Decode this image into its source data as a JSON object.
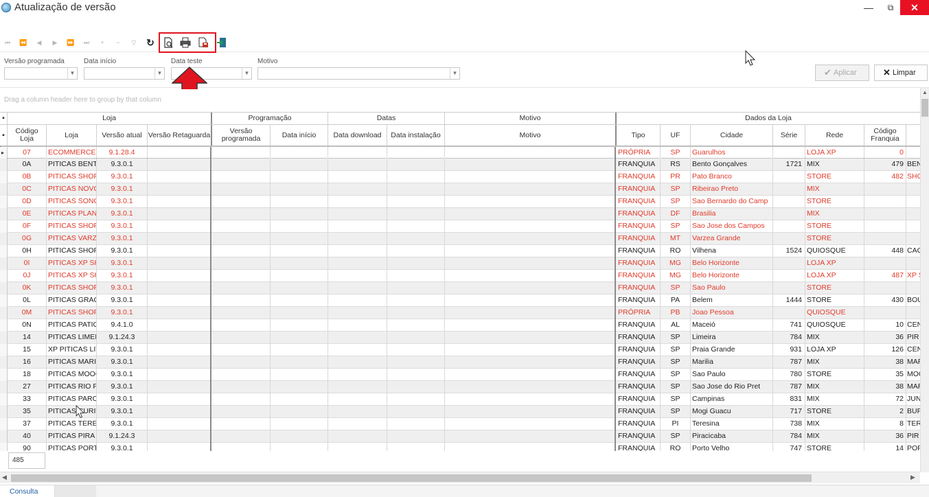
{
  "window": {
    "title": "Atualização de versão",
    "min": "—",
    "max": "⧉",
    "close": "✕"
  },
  "toolbar": {
    "nav_first": "⏮",
    "nav_prev_page": "⏪",
    "nav_prev": "◀",
    "nav_next": "▶",
    "nav_next_page": "⏩",
    "nav_last": "⏭",
    "add": "+",
    "remove": "−",
    "filter": "▽",
    "refresh": "↻"
  },
  "filters": {
    "versao_programada_label": "Versão programada",
    "data_inicio_label": "Data início",
    "data_teste_label": "Data teste",
    "motivo_label": "Motivo"
  },
  "buttons": {
    "aplicar": "Aplicar",
    "limpar": "Limpar"
  },
  "group_panel": "Drag a column header here to group by that column",
  "bands": {
    "loja": "Loja",
    "programacao": "Programação",
    "datas": "Datas",
    "motivo": "Motivo",
    "dados_loja": "Dados da Loja"
  },
  "columns": {
    "codigo_loja": "Código Loja",
    "loja": "Loja",
    "versao_atual": "Versão atual",
    "versao_retaguarda": "Versão Retaguarda",
    "versao_programada": "Versão programada",
    "data_inicio": "Data início",
    "data_download": "Data download",
    "data_instalacao": "Data instalação",
    "motivo": "Motivo",
    "tipo": "Tipo",
    "uf": "UF",
    "cidade": "Cidade",
    "serie": "Série",
    "rede": "Rede",
    "codigo_franquia": "Código Franquia"
  },
  "rows": [
    {
      "cod": "07",
      "loja": "ECOMMERCE P",
      "ver": "9.1.28.4",
      "tipo": "PRÓPRIA",
      "uf": "SP",
      "cidade": "Guarulhos",
      "serie": "",
      "rede": "LOJA XP",
      "cf": "0",
      "x": "",
      "red": true
    },
    {
      "cod": "0A",
      "loja": "PITICAS BENTO",
      "ver": "9.3.0.1",
      "tipo": "FRANQUIA",
      "uf": "RS",
      "cidade": "Bento Gonçalves",
      "serie": "1721",
      "rede": "MIX",
      "cf": "479",
      "x": "BEN",
      "red": false
    },
    {
      "cod": "0B",
      "loja": "PITICAS SHOP",
      "ver": "9.3.0.1",
      "tipo": "FRANQUIA",
      "uf": "PR",
      "cidade": "Pato Branco",
      "serie": "",
      "rede": "STORE",
      "cf": "482",
      "x": "SHO",
      "red": true
    },
    {
      "cod": "0C",
      "loja": "PITICAS NOVO",
      "ver": "9.3.0.1",
      "tipo": "FRANQUIA",
      "uf": "SP",
      "cidade": "Ribeirao Preto",
      "serie": "",
      "rede": "MIX",
      "cf": "",
      "x": "",
      "red": true
    },
    {
      "cod": "0D",
      "loja": "PITICAS SONO",
      "ver": "9.3.0.1",
      "tipo": "FRANQUIA",
      "uf": "SP",
      "cidade": "Sao Bernardo do Camp",
      "serie": "",
      "rede": "STORE",
      "cf": "",
      "x": "",
      "red": true
    },
    {
      "cod": "0E",
      "loja": "PITICAS PLAN",
      "ver": "9.3.0.1",
      "tipo": "FRANQUIA",
      "uf": "DF",
      "cidade": "Brasilia",
      "serie": "",
      "rede": "MIX",
      "cf": "",
      "x": "",
      "red": true
    },
    {
      "cod": "0F",
      "loja": "PITICAS SHOP",
      "ver": "9.3.0.1",
      "tipo": "FRANQUIA",
      "uf": "SP",
      "cidade": "Sao Jose dos Campos",
      "serie": "",
      "rede": "STORE",
      "cf": "",
      "x": "",
      "red": true
    },
    {
      "cod": "0G",
      "loja": "PITICAS VARZ",
      "ver": "9.3.0.1",
      "tipo": "FRANQUIA",
      "uf": "MT",
      "cidade": "Varzea Grande",
      "serie": "",
      "rede": "STORE",
      "cf": "",
      "x": "",
      "red": true
    },
    {
      "cod": "0H",
      "loja": "PITICAS SHOP",
      "ver": "9.3.0.1",
      "tipo": "FRANQUIA",
      "uf": "RO",
      "cidade": "Vilhena",
      "serie": "1524",
      "rede": "QUIOSQUE",
      "cf": "448",
      "x": "CAC",
      "red": false
    },
    {
      "cod": "0I",
      "loja": "PITICAS XP SH",
      "ver": "9.3.0.1",
      "tipo": "FRANQUIA",
      "uf": "MG",
      "cidade": "Belo Horizonte",
      "serie": "",
      "rede": "LOJA XP",
      "cf": "",
      "x": "",
      "red": true
    },
    {
      "cod": "0J",
      "loja": "PITICAS XP SH",
      "ver": "9.3.0.1",
      "tipo": "FRANQUIA",
      "uf": "MG",
      "cidade": "Belo Horizonte",
      "serie": "",
      "rede": "LOJA XP",
      "cf": "487",
      "x": "XP S",
      "red": true
    },
    {
      "cod": "0K",
      "loja": "PITICAS SHOP",
      "ver": "9.3.0.1",
      "tipo": "FRANQUIA",
      "uf": "SP",
      "cidade": "Sao Paulo",
      "serie": "",
      "rede": "STORE",
      "cf": "",
      "x": "",
      "red": true
    },
    {
      "cod": "0L",
      "loja": "PITICAS GRAC",
      "ver": "9.3.0.1",
      "tipo": "FRANQUIA",
      "uf": "PA",
      "cidade": "Belem",
      "serie": "1444",
      "rede": "STORE",
      "cf": "430",
      "x": "BOU",
      "red": false
    },
    {
      "cod": "0M",
      "loja": "PITICAS SHOP",
      "ver": "9.3.0.1",
      "tipo": "PRÓPRIA",
      "uf": "PB",
      "cidade": "Joao Pessoa",
      "serie": "",
      "rede": "QUIOSQUE",
      "cf": "",
      "x": "",
      "red": true
    },
    {
      "cod": "0N",
      "loja": "PITICAS PATIO",
      "ver": "9.4.1.0",
      "tipo": "FRANQUIA",
      "uf": "AL",
      "cidade": "Maceió",
      "serie": "741",
      "rede": "QUIOSQUE",
      "cf": "10",
      "x": "CEN",
      "red": false
    },
    {
      "cod": "14",
      "loja": "PITICAS LIMEI",
      "ver": "9.1.24.3",
      "tipo": "FRANQUIA",
      "uf": "SP",
      "cidade": "Limeira",
      "serie": "784",
      "rede": "MIX",
      "cf": "36",
      "x": "PIR",
      "red": false
    },
    {
      "cod": "15",
      "loja": "XP PITICAS LIT",
      "ver": "9.3.0.1",
      "tipo": "FRANQUIA",
      "uf": "SP",
      "cidade": "Praia Grande",
      "serie": "931",
      "rede": "LOJA XP",
      "cf": "126",
      "x": "CEN",
      "red": false
    },
    {
      "cod": "16",
      "loja": "PITICAS MARI",
      "ver": "9.3.0.1",
      "tipo": "FRANQUIA",
      "uf": "SP",
      "cidade": "Marilia",
      "serie": "787",
      "rede": "MIX",
      "cf": "38",
      "x": "MAR",
      "red": false
    },
    {
      "cod": "18",
      "loja": "PITICAS MOOC",
      "ver": "9.3.0.1",
      "tipo": "FRANQUIA",
      "uf": "SP",
      "cidade": "Sao Paulo",
      "serie": "780",
      "rede": "STORE",
      "cf": "35",
      "x": "MOO",
      "red": false
    },
    {
      "cod": "27",
      "loja": "PITICAS RIO P",
      "ver": "9.3.0.1",
      "tipo": "FRANQUIA",
      "uf": "SP",
      "cidade": "Sao Jose do Rio Pret",
      "serie": "787",
      "rede": "MIX",
      "cf": "38",
      "x": "MAR",
      "red": false
    },
    {
      "cod": "33",
      "loja": "PITICAS PARC",
      "ver": "9.3.0.1",
      "tipo": "FRANQUIA",
      "uf": "SP",
      "cidade": "Campinas",
      "serie": "831",
      "rede": "MIX",
      "cf": "72",
      "x": "JUN",
      "red": false
    },
    {
      "cod": "35",
      "loja": "PITICAS CURIT",
      "ver": "9.3.0.1",
      "tipo": "FRANQUIA",
      "uf": "SP",
      "cidade": "Mogi Guacu",
      "serie": "717",
      "rede": "STORE",
      "cf": "2",
      "x": "BUF",
      "red": false
    },
    {
      "cod": "37",
      "loja": "PITICAS TERES",
      "ver": "9.3.0.1",
      "tipo": "FRANQUIA",
      "uf": "PI",
      "cidade": "Teresina",
      "serie": "738",
      "rede": "MIX",
      "cf": "8",
      "x": "TER",
      "red": false
    },
    {
      "cod": "40",
      "loja": "PITICAS PIRA",
      "ver": "9.1.24.3",
      "tipo": "FRANQUIA",
      "uf": "SP",
      "cidade": "Piracicaba",
      "serie": "784",
      "rede": "MIX",
      "cf": "36",
      "x": "PIR",
      "red": false
    },
    {
      "cod": "90",
      "loja": "PITICAS PORT",
      "ver": "9.3.0.1",
      "tipo": "FRANQUIA",
      "uf": "RO",
      "cidade": "Porto Velho",
      "serie": "747",
      "rede": "STORE",
      "cf": "14",
      "x": "POF",
      "red": false
    }
  ],
  "footer": {
    "record_count": "485",
    "tab_consulta": "Consulta"
  },
  "colors": {
    "accent_red": "#e0141e",
    "row_red_text": "#e03a2a"
  }
}
